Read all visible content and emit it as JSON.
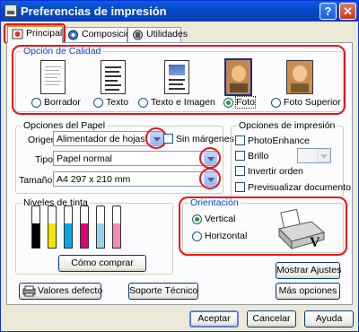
{
  "window": {
    "title": "Preferencias de impresión",
    "help_label": "?",
    "close_label": "✕"
  },
  "tabs": [
    {
      "label": "Principal",
      "active": true
    },
    {
      "label": "Composición",
      "active": false
    },
    {
      "label": "Utilidades",
      "active": false
    }
  ],
  "quality": {
    "group_label": "Opción de Calidad",
    "options": [
      {
        "label": "Borrador",
        "checked": false,
        "icon": "draft-doc-icon"
      },
      {
        "label": "Texto",
        "checked": false,
        "icon": "text-doc-icon"
      },
      {
        "label": "Texto e Imagen",
        "checked": false,
        "icon": "text-image-doc-icon"
      },
      {
        "label": "Foto",
        "checked": true,
        "icon": "photo-icon"
      },
      {
        "label": "Foto Superior",
        "checked": false,
        "icon": "best-photo-icon"
      }
    ]
  },
  "paper": {
    "group_label": "Opciones del Papel",
    "source_label": "Origen:",
    "source_value": "Alimentador de hojas",
    "borderless_label": "Sin márgenes",
    "type_label": "Tipo:",
    "type_value": "Papel normal",
    "size_label": "Tamaño:",
    "size_value": "A4 297 x 210 mm"
  },
  "print_options": {
    "group_label": "Opciones de impresión",
    "photo_enhance_label": "PhotoEnhance",
    "brightness_label": "Brillo",
    "reverse_label": "Invertir orden",
    "preview_label": "Previsualizar documento"
  },
  "ink": {
    "group_label": "Niveles de tinta",
    "buy_button": "Cómo comprar",
    "cartridges": [
      {
        "color": "#000000",
        "level": 0.65
      },
      {
        "color": "#f5e400",
        "level": 0.65
      },
      {
        "color": "#00a6e6",
        "level": 0.65
      },
      {
        "color": "#e0007a",
        "level": 0.65
      },
      {
        "color": "#8fd3f2",
        "level": 0.65
      },
      {
        "color": "#f48ab8",
        "level": 0.65
      }
    ]
  },
  "orientation": {
    "group_label": "Orientación",
    "portrait_label": "Vertical",
    "landscape_label": "Horizontal",
    "portrait_checked": true
  },
  "buttons": {
    "show_settings": "Mostrar Ajustes",
    "defaults": "Valores defecto",
    "tech_support": "Soporte Técnico",
    "more_options": "Más opciones",
    "accept": "Aceptar",
    "cancel": "Cancelar",
    "help": "Ayuda"
  }
}
